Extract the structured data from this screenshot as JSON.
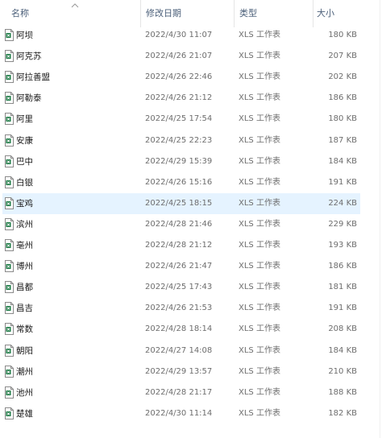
{
  "columns": {
    "name": "名称",
    "date_modified": "修改日期",
    "type": "类型",
    "size": "大小"
  },
  "sort": {
    "column": "name",
    "direction": "ascending",
    "icon": "sort-up-chevron-icon"
  },
  "file_icon": "xls-file-icon",
  "colors": {
    "selected_row": "#e5f3ff",
    "icon_green": "#1d7a45"
  },
  "selected_index": 8,
  "files": [
    {
      "name": "阿坝",
      "date": "2022/4/30 11:07",
      "type": "XLS 工作表",
      "size": "180 KB"
    },
    {
      "name": "阿克苏",
      "date": "2022/4/26 21:07",
      "type": "XLS 工作表",
      "size": "207 KB"
    },
    {
      "name": "阿拉善盟",
      "date": "2022/4/26 22:46",
      "type": "XLS 工作表",
      "size": "202 KB"
    },
    {
      "name": "阿勒泰",
      "date": "2022/4/26 21:12",
      "type": "XLS 工作表",
      "size": "186 KB"
    },
    {
      "name": "阿里",
      "date": "2022/4/25 17:54",
      "type": "XLS 工作表",
      "size": "180 KB"
    },
    {
      "name": "安康",
      "date": "2022/4/25 22:23",
      "type": "XLS 工作表",
      "size": "187 KB"
    },
    {
      "name": "巴中",
      "date": "2022/4/29 15:39",
      "type": "XLS 工作表",
      "size": "184 KB"
    },
    {
      "name": "白银",
      "date": "2022/4/26 15:16",
      "type": "XLS 工作表",
      "size": "191 KB"
    },
    {
      "name": "宝鸡",
      "date": "2022/4/25 18:15",
      "type": "XLS 工作表",
      "size": "224 KB"
    },
    {
      "name": "滨州",
      "date": "2022/4/28 21:46",
      "type": "XLS 工作表",
      "size": "229 KB"
    },
    {
      "name": "亳州",
      "date": "2022/4/28 21:12",
      "type": "XLS 工作表",
      "size": "193 KB"
    },
    {
      "name": "博州",
      "date": "2022/4/26 21:47",
      "type": "XLS 工作表",
      "size": "186 KB"
    },
    {
      "name": "昌都",
      "date": "2022/4/25 17:43",
      "type": "XLS 工作表",
      "size": "181 KB"
    },
    {
      "name": "昌吉",
      "date": "2022/4/26 21:53",
      "type": "XLS 工作表",
      "size": "191 KB"
    },
    {
      "name": "常数",
      "date": "2022/4/28 18:14",
      "type": "XLS 工作表",
      "size": "208 KB"
    },
    {
      "name": "朝阳",
      "date": "2022/4/27 14:08",
      "type": "XLS 工作表",
      "size": "184 KB"
    },
    {
      "name": "潮州",
      "date": "2022/4/29 13:57",
      "type": "XLS 工作表",
      "size": "210 KB"
    },
    {
      "name": "池州",
      "date": "2022/4/28 21:17",
      "type": "XLS 工作表",
      "size": "188 KB"
    },
    {
      "name": "楚雄",
      "date": "2022/4/30 11:14",
      "type": "XLS 工作表",
      "size": "182 KB"
    }
  ]
}
